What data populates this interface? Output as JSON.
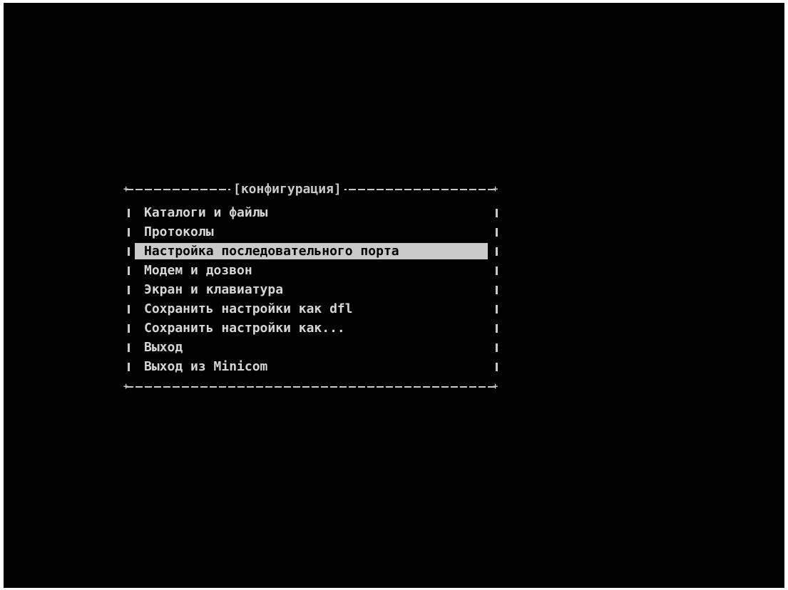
{
  "menu": {
    "title": "[конфигурация]",
    "items": [
      {
        "label": "Каталоги и файлы",
        "selected": false
      },
      {
        "label": "Протоколы",
        "selected": false
      },
      {
        "label": "Настройка последовательного порта",
        "selected": true
      },
      {
        "label": "Модем и дозвон",
        "selected": false
      },
      {
        "label": "Экран и клавиатура",
        "selected": false
      },
      {
        "label": "Сохранить настройки как dfl",
        "selected": false
      },
      {
        "label": "Сохранить настройки как...",
        "selected": false
      },
      {
        "label": "Выход",
        "selected": false
      },
      {
        "label": "Выход из Minicom",
        "selected": false
      }
    ]
  },
  "colors": {
    "background": "#000000",
    "text": "#c9c9c9",
    "highlight": "#c9c9c9",
    "highlight_text": "#000000"
  }
}
